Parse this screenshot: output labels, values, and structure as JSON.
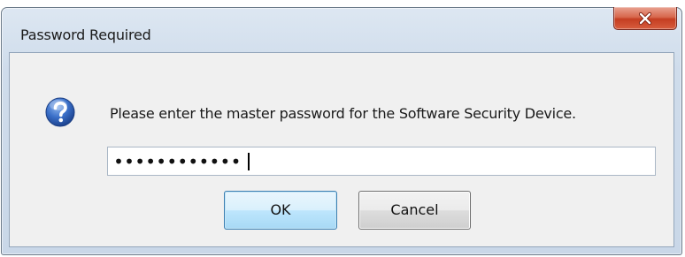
{
  "window": {
    "title": "Password Required",
    "close_glyph": "X"
  },
  "dialog": {
    "icon": "question-icon",
    "message": "Please enter the master password for the Software Security Device.",
    "password_value": "••••••••••••",
    "ok_label": "OK",
    "cancel_label": "Cancel"
  },
  "colors": {
    "close_button": "#c53e22",
    "question_icon": "#2a5cb0",
    "ok_button_border": "#3c7fb1"
  }
}
